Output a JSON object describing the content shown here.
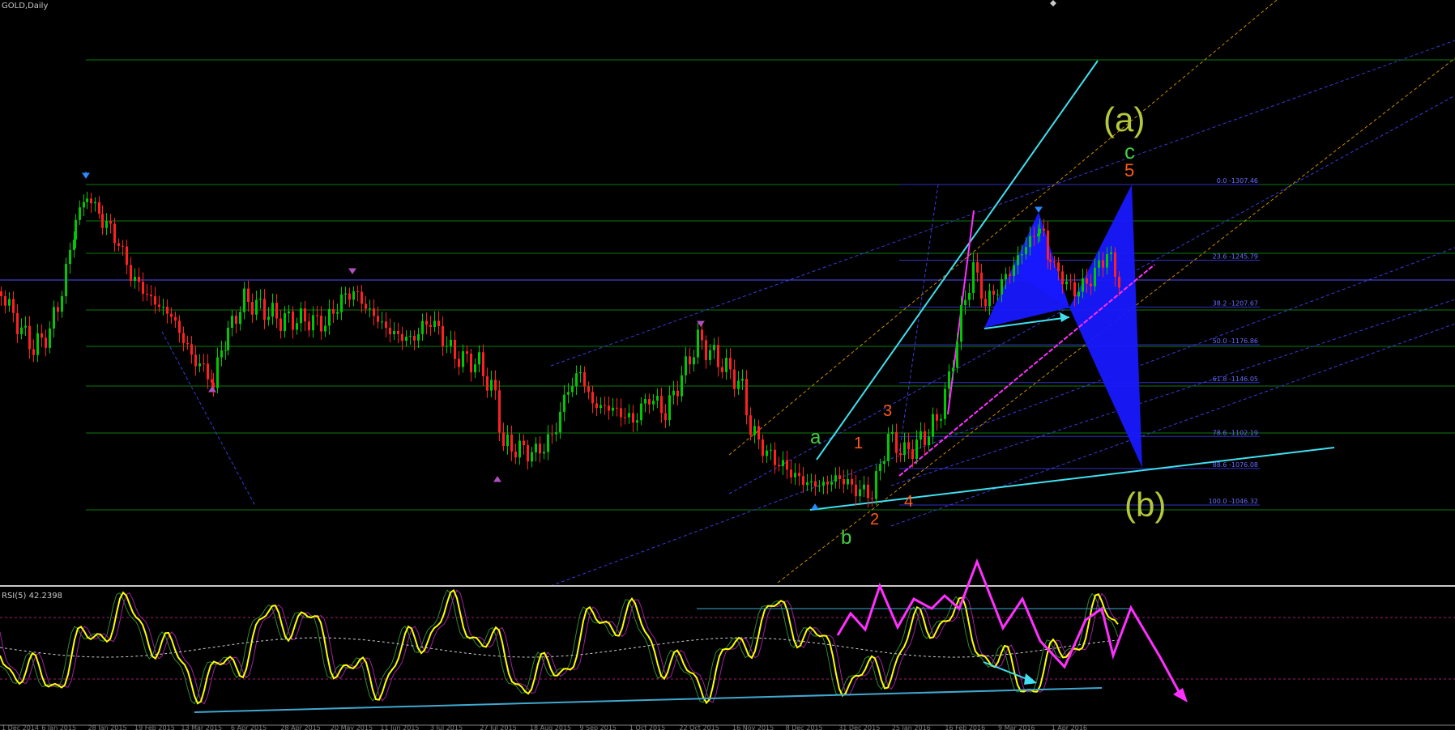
{
  "window": {
    "title": "GOLD,Daily"
  },
  "main_chart": {
    "symbol": "GOLD",
    "timeframe": "Daily",
    "fib_levels": [
      {
        "label": "0.0 -1307.46",
        "value": 1307.46
      },
      {
        "label": "23.6 -1245.79",
        "value": 1245.79
      },
      {
        "label": "38.2 -1207.67",
        "value": 1207.67
      },
      {
        "label": "50.0 -1176.86",
        "value": 1176.86
      },
      {
        "label": "61.8 -1146.05",
        "value": 1146.05
      },
      {
        "label": "78.6 -1102.19",
        "value": 1102.19
      },
      {
        "label": "88.6 -1076.08",
        "value": 1076.08
      },
      {
        "label": "100.0 -1046.32",
        "value": 1046.32
      }
    ],
    "wave_labels": {
      "a_upper": "(a)",
      "b_upper": "(b)",
      "c_green": "c",
      "five": "5",
      "a_green": "a",
      "b_green": "b",
      "one": "1",
      "two": "2",
      "three": "3",
      "four": "4"
    }
  },
  "rsi": {
    "label": "RSI(5) 42.2398",
    "period": 5,
    "value": 42.2398
  },
  "x_axis": {
    "ticks": [
      "1 Dec 2014",
      "6 Jan 2015",
      "28 Jan 2015",
      "19 Feb 2015",
      "13 Mar 2015",
      "6 Apr 2015",
      "28 Apr 2015",
      "20 May 2015",
      "11 Jun 2015",
      "3 Jul 2015",
      "27 Jul 2015",
      "18 Aug 2015",
      "9 Sep 2015",
      "1 Oct 2015",
      "22 Oct 2015",
      "16 Nov 2015",
      "8 Dec 2015",
      "31 Dec 2015",
      "25 Jan 2016",
      "16 Feb 2016",
      "9 Mar 2016",
      "1 Apr 2016"
    ]
  },
  "colors": {
    "background": "#000000",
    "bull_candle": "#00c800",
    "bear_candle": "#ff2020",
    "horizontal_green": "#0a6a0a",
    "fib_line": "#3030c0",
    "cyan_trend": "#40e0f0",
    "magenta": "#ff30ff",
    "orange_dashed": "#d08a00",
    "blue_pattern": "#1a1aff",
    "rsi_line": "#ffff00",
    "wave_green": "#40d040",
    "wave_orange": "#ff5a1a",
    "wave_olive": "#b4c83c"
  }
}
